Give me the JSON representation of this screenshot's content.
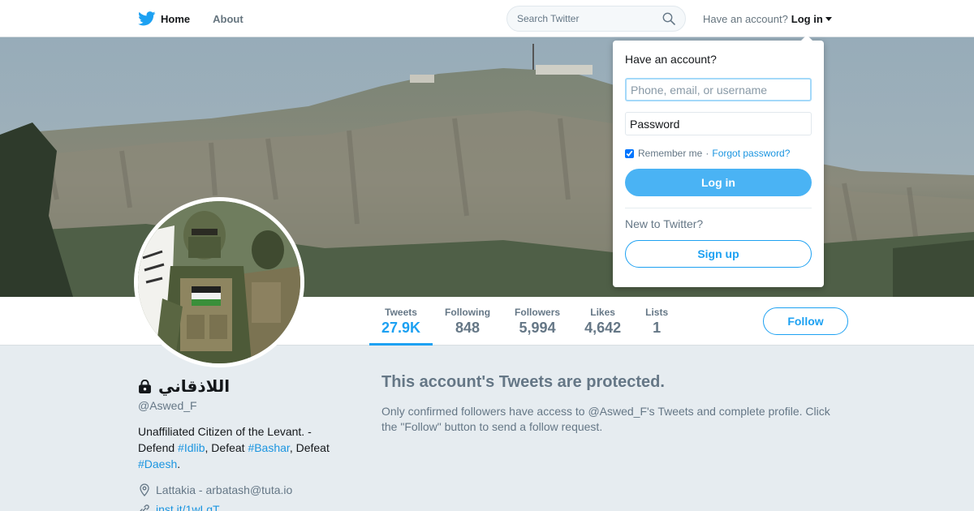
{
  "nav": {
    "home": "Home",
    "about": "About",
    "search_placeholder": "Search Twitter",
    "have_account": "Have an account?",
    "login": "Log in"
  },
  "login_dropdown": {
    "title": "Have an account?",
    "username_placeholder": "Phone, email, or username",
    "password_placeholder": "Password",
    "remember_me": "Remember me",
    "separator": "·",
    "forgot_password": "Forgot password?",
    "login_button": "Log in",
    "new_to_twitter": "New to Twitter?",
    "signup_button": "Sign up"
  },
  "profile": {
    "display_name": "اللاذقاني",
    "handle": "@Aswed_F",
    "bio": {
      "text1": "Unaffiliated Citizen of the Levant. - Defend ",
      "tag1": "#Idlib",
      "text2": ", Defeat ",
      "tag2": "#Bashar",
      "text3": ", Defeat ",
      "tag3": "#Daesh",
      "text4": "."
    },
    "location": "Lattakia - arbatash@tuta.io",
    "url": "inst.it/1wLgT"
  },
  "stats": [
    {
      "label": "Tweets",
      "value": "27.9K",
      "active": true
    },
    {
      "label": "Following",
      "value": "848"
    },
    {
      "label": "Followers",
      "value": "5,994"
    },
    {
      "label": "Likes",
      "value": "4,642"
    },
    {
      "label": "Lists",
      "value": "1"
    }
  ],
  "follow_button": "Follow",
  "protected": {
    "heading": "This account's Tweets are protected.",
    "message": "Only confirmed followers have access to @Aswed_F's Tweets and complete profile. Click the \"Follow\" button to send a follow request."
  },
  "colors": {
    "accent": "#1da1f2",
    "link": "#1b95e0",
    "background": "#e6ecf0"
  },
  "icons": [
    "twitter-bird-icon",
    "search-icon",
    "lock-icon",
    "location-pin-icon",
    "link-icon"
  ]
}
